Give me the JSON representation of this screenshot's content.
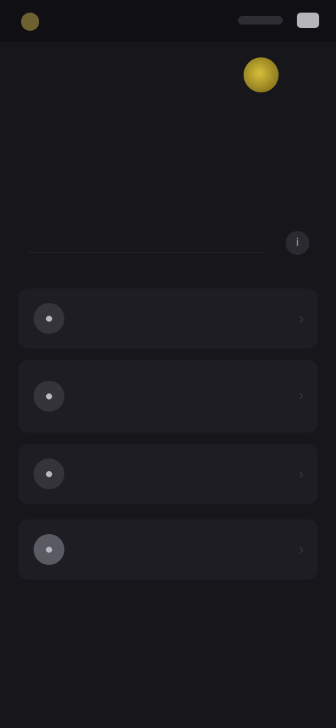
{
  "status_bar": {
    "time": "",
    "network": ""
  },
  "header": {
    "coin_label": ""
  },
  "page": {
    "title": ""
  },
  "note": {
    "text_start": "",
    "text_accent": "",
    "text_end": ""
  },
  "options": [
    {
      "title": "",
      "description": "",
      "icon": "user-icon"
    },
    {
      "title": "",
      "description": "",
      "icon": "user-icon"
    },
    {
      "title": "",
      "description": "",
      "icon": "user-icon"
    },
    {
      "title": "",
      "description": "",
      "icon": "user-icon"
    }
  ],
  "colors": {
    "background": "#16161b",
    "card": "#1d1d23",
    "accent_green": "#2e9a43",
    "coin": "#d6bf3a"
  }
}
